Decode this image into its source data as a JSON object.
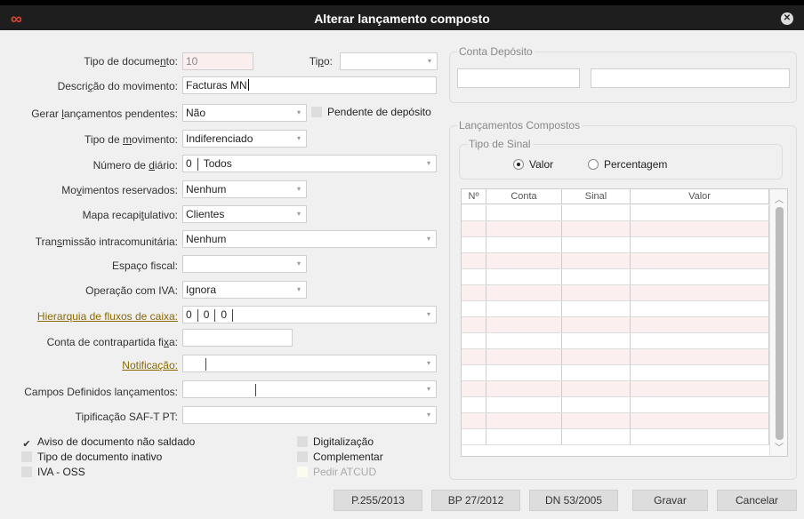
{
  "window": {
    "title": "Alterar lançamento composto",
    "logo_glyph": "∞",
    "close_glyph": "✕"
  },
  "form": {
    "tipo_documento": {
      "label_pre": "Tipo de docume",
      "label_u": "n",
      "label_post": "to:",
      "value": "10"
    },
    "tipo": {
      "label_pre": "Ti",
      "label_u": "p",
      "label_post": "o:",
      "value": ""
    },
    "descricao": {
      "label_pre": "Descri",
      "label_u": "ç",
      "label_post": "ão do movimento:",
      "value": "Facturas MN"
    },
    "gerar": {
      "label_pre": "Gerar ",
      "label_u": "l",
      "label_post": "ançamentos pendentes:",
      "value": "Não"
    },
    "pendente_deposito": "Pendente de depósito",
    "tipo_movimento": {
      "label_pre": "Tipo de ",
      "label_u": "m",
      "label_post": "ovimento:",
      "value": "Indiferenciado"
    },
    "numero_diario": {
      "label_pre": "Número de ",
      "label_u": "d",
      "label_post": "iário:",
      "value_num": "0",
      "value_text": "Todos"
    },
    "movimentos_reservados": {
      "label_pre": "Mo",
      "label_u": "v",
      "label_post": "imentos reservados:",
      "value": "Nenhum"
    },
    "mapa_recapitulativo": {
      "label_pre": "Mapa recapi",
      "label_u": "t",
      "label_post": "ulativo:",
      "value": "Clientes"
    },
    "transmissao": {
      "label_pre": "Tran",
      "label_u": "s",
      "label_post": "missão intracomunitária:",
      "value": "Nenhum"
    },
    "espaco_fiscal": {
      "label": "Espaço fiscal:",
      "value": ""
    },
    "operacao_iva": {
      "label": "Operação com IVA:",
      "value": "Ignora"
    },
    "hierarquia": {
      "label": "Hierarquia de fluxos de caixa:",
      "v1": "0",
      "v2": "0",
      "v3": "0"
    },
    "conta_contrapartida": {
      "label_pre": "Conta de contrapartida fi",
      "label_u": "x",
      "label_post": "a:",
      "value": ""
    },
    "notificacao": {
      "label": "Notificação:",
      "value": ""
    },
    "campos_definidos": {
      "label": "Campos Definidos lançamentos:",
      "value": ""
    },
    "tipificacao": {
      "label": "Tipificação SAF-T PT:",
      "value": ""
    }
  },
  "checks": {
    "aviso": {
      "label": "Aviso de documento não saldado",
      "checked": true
    },
    "inativo": {
      "label": "Tipo de documento inativo",
      "checked": false
    },
    "iva_oss": {
      "label": "IVA - OSS",
      "checked": false
    },
    "digitalizacao": {
      "label": "Digitalização",
      "checked": false
    },
    "complementar": {
      "label": "Complementar",
      "checked": false
    },
    "pedir_atcud": {
      "label": "Pedir ATCUD",
      "checked": false
    }
  },
  "conta_deposito": {
    "legend": "Conta Depósito",
    "field1": "",
    "field2": ""
  },
  "lancamentos": {
    "legend": "Lançamentos Compostos",
    "tipo_sinal": {
      "legend": "Tipo de Sinal",
      "valor": "Valor",
      "percentagem": "Percentagem",
      "selected": "Valor"
    },
    "columns": [
      "Nº",
      "Conta",
      "Sinal",
      "Valor"
    ]
  },
  "buttons": {
    "p255": "P.255/2013",
    "bp27": "BP 27/2012",
    "dn53": "DN 53/2005",
    "gravar": "Gravar",
    "cancelar": "Cancelar"
  },
  "icons": {
    "dropdown": "chevron-down-icon",
    "check": "checkmark-icon",
    "close": "close-icon",
    "logo": "infinity-logo-icon"
  }
}
